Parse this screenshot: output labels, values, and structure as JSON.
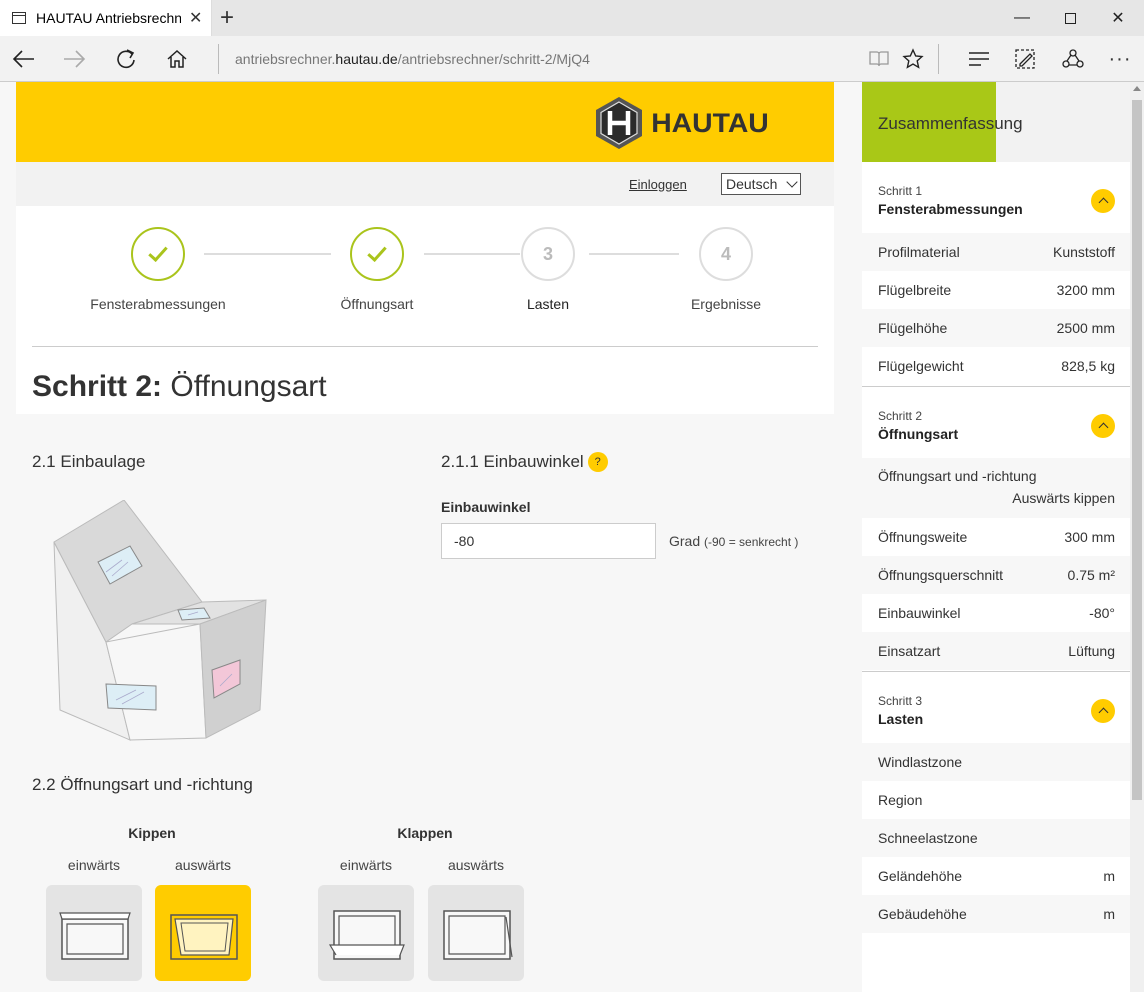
{
  "browser": {
    "tab_title": "HAUTAU Antriebsrechner",
    "url_prefix": "antriebsrechner.",
    "url_domain": "hautau.de",
    "url_path": "/antriebsrechner/schritt-2/MjQ4"
  },
  "header": {
    "logo_text": "HAUTAU",
    "logo_letter": "H"
  },
  "subbar": {
    "login": "Einloggen",
    "language": "Deutsch"
  },
  "steps": [
    {
      "num": "1",
      "label": "Fensterabmessungen",
      "done": true
    },
    {
      "num": "2",
      "label": "Öffnungsart",
      "done": true
    },
    {
      "num": "3",
      "label": "Lasten",
      "done": false
    },
    {
      "num": "4",
      "label": "Ergebnisse",
      "done": false
    }
  ],
  "page": {
    "title_bold": "Schritt 2:",
    "title_rest": " Öffnungsart",
    "sec_einbaulage": "2.1 Einbaulage",
    "sec_einbauwinkel": "2.1.1 Einbauwinkel",
    "help": "?",
    "field_label": "Einbauwinkel",
    "field_value": "-80",
    "unit": "Grad ",
    "unit_hint": "(-90 = senkrecht )",
    "sec_oeffnungsart": "2.2 Öffnungsart und -richtung",
    "group_kippen": "Kippen",
    "group_klappen": "Klappen",
    "inward": "einwärts",
    "outward": "auswärts"
  },
  "summary": {
    "title": "Zusammenfassung",
    "step1": {
      "label": "Schritt 1",
      "name": "Fensterabmessungen",
      "rows": [
        {
          "k": "Profilmaterial",
          "v": "Kunststoff"
        },
        {
          "k": "Flügelbreite",
          "v": "3200 mm"
        },
        {
          "k": "Flügelhöhe",
          "v": "2500 mm"
        },
        {
          "k": "Flügelgewicht",
          "v": "828,5 kg"
        }
      ]
    },
    "step2": {
      "label": "Schritt 2",
      "name": "Öffnungsart",
      "tall_row": {
        "k": "Öffnungsart und -richtung",
        "v": "Auswärts kippen"
      },
      "rows": [
        {
          "k": "Öffnungsweite",
          "v": "300 mm"
        },
        {
          "k": "Öffnungsquerschnitt",
          "v": "0.75 m²"
        },
        {
          "k": "Einbauwinkel",
          "v": "-80°"
        },
        {
          "k": "Einsatzart",
          "v": "Lüftung"
        }
      ]
    },
    "step3": {
      "label": "Schritt 3",
      "name": "Lasten",
      "rows": [
        {
          "k": "Windlastzone",
          "v": ""
        },
        {
          "k": "Region",
          "v": ""
        },
        {
          "k": "Schneelastzone",
          "v": ""
        },
        {
          "k": "Geländehöhe",
          "v": "m"
        },
        {
          "k": "Gebäudehöhe",
          "v": "m"
        }
      ]
    }
  },
  "colors": {
    "brand_yellow": "#ffcc00",
    "accent_green": "#a9c817"
  }
}
